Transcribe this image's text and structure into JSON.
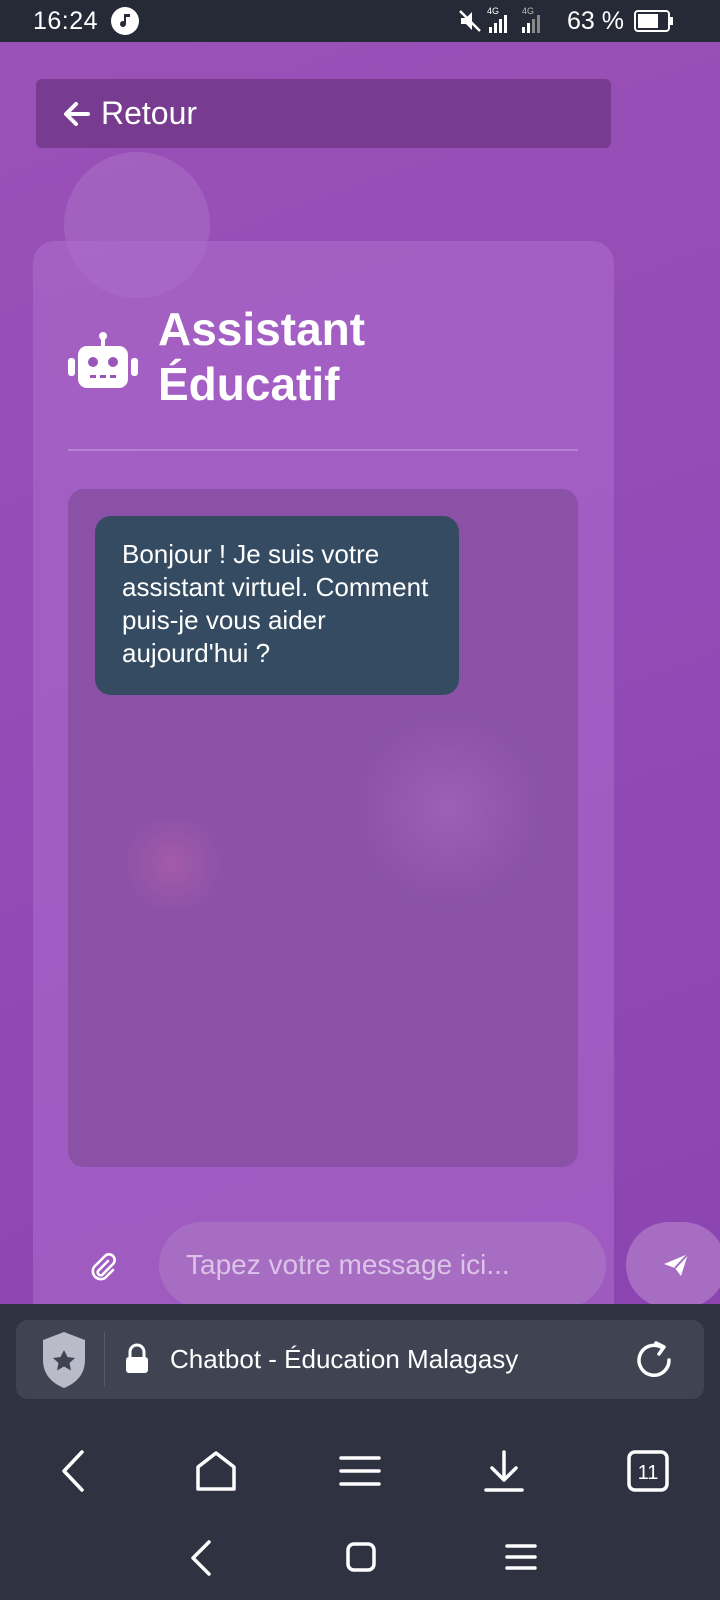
{
  "status_bar": {
    "time": "16:24",
    "battery": "63 %",
    "network_1": "4G",
    "network_2": "4G",
    "icons": [
      "music-note-icon",
      "mute-icon",
      "signal-icon",
      "battery-icon"
    ]
  },
  "header": {
    "back_label": "Retour"
  },
  "assistant": {
    "title": "Assistant Éducatif",
    "icon": "robot-icon"
  },
  "chat": {
    "messages": [
      {
        "sender": "bot",
        "text": "Bonjour ! Je suis votre assistant virtuel. Comment puis-je vous aider aujourd'hui ?"
      }
    ]
  },
  "composer": {
    "placeholder": "Tapez votre message ici...",
    "attach_icon": "paperclip-icon",
    "send_icon": "send-icon"
  },
  "browser": {
    "page_title": "Chatbot - Éducation Malagasy",
    "tab_count": "11"
  },
  "colors": {
    "background": "#9550b6",
    "bubble": "#344b61",
    "back_button": "#773c8f",
    "browser_bar": "#2f3240"
  }
}
